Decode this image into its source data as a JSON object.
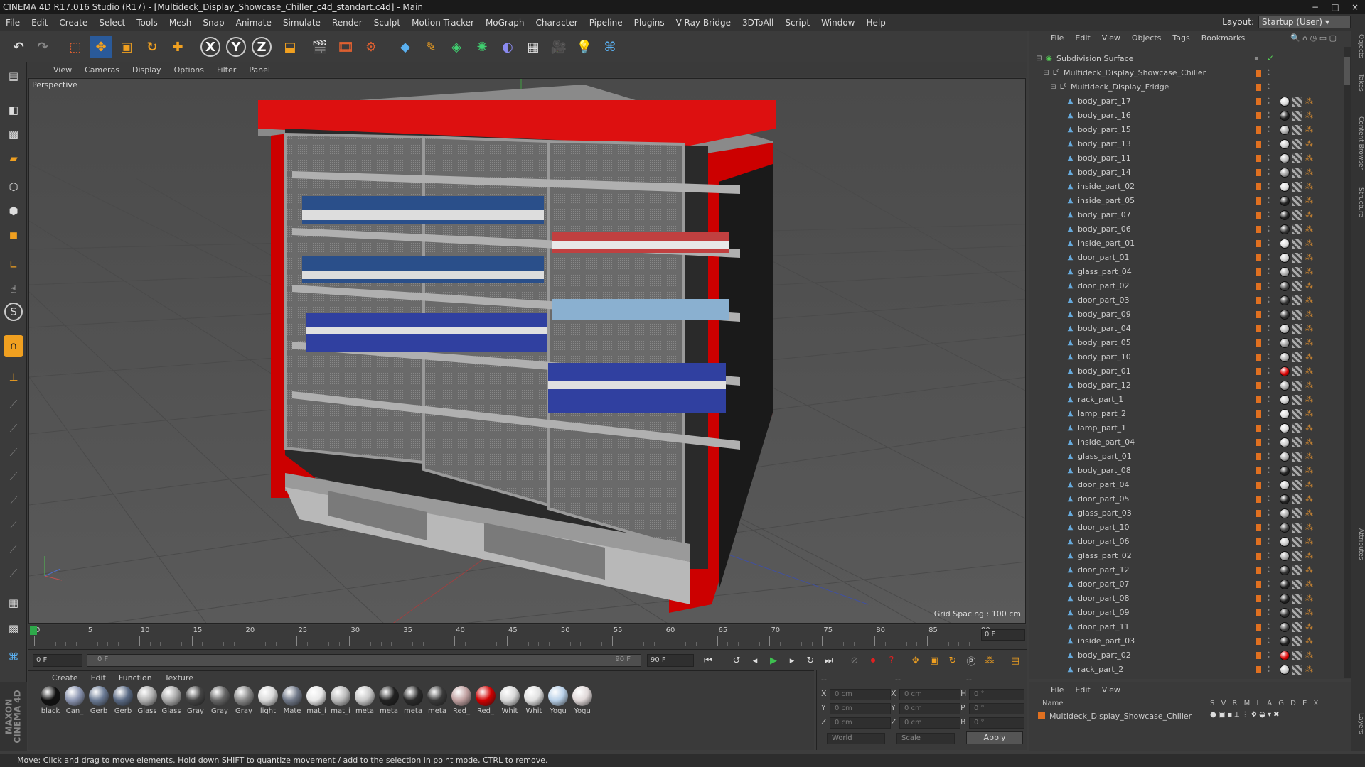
{
  "window": {
    "title": "CINEMA 4D R17.016 Studio (R17) - [Multideck_Display_Showcase_Chiller_c4d_standart.c4d] - Main",
    "controls": [
      "−",
      "□",
      "×"
    ]
  },
  "menu": [
    "File",
    "Edit",
    "Create",
    "Select",
    "Tools",
    "Mesh",
    "Snap",
    "Animate",
    "Simulate",
    "Render",
    "Sculpt",
    "Motion Tracker",
    "MoGraph",
    "Character",
    "Pipeline",
    "Plugins",
    "V-Ray Bridge",
    "3DToAll",
    "Script",
    "Window",
    "Help"
  ],
  "layout": {
    "label": "Layout:",
    "value": "Startup (User)"
  },
  "toolbar": {
    "axis_x": "X",
    "axis_y": "Y",
    "axis_z": "Z"
  },
  "viewport": {
    "menu": [
      "View",
      "Cameras",
      "Display",
      "Options",
      "Filter",
      "Panel"
    ],
    "label": "Perspective",
    "grid": "Grid Spacing : 100 cm"
  },
  "timeline": {
    "ticks": [
      "0",
      "5",
      "10",
      "15",
      "20",
      "25",
      "30",
      "35",
      "40",
      "45",
      "50",
      "55",
      "60",
      "65",
      "70",
      "75",
      "80",
      "85",
      "90"
    ],
    "frame_right": "0 F"
  },
  "anim": {
    "start": "0 F",
    "range_start": "0 F",
    "range_end": "90 F",
    "end": "90 F"
  },
  "materials": {
    "menu": [
      "Create",
      "Edit",
      "Function",
      "Texture"
    ],
    "items": [
      {
        "label": "black",
        "color": "#111111"
      },
      {
        "label": "Can_",
        "color": "#8a94b0"
      },
      {
        "label": "Gerb",
        "color": "#6a7a94"
      },
      {
        "label": "Gerb",
        "color": "#5a6a84"
      },
      {
        "label": "Glass",
        "color": "#b0b0b0"
      },
      {
        "label": "Glass",
        "color": "#a8a8a8"
      },
      {
        "label": "Gray",
        "color": "#444444"
      },
      {
        "label": "Gray",
        "color": "#666666"
      },
      {
        "label": "Gray",
        "color": "#888888"
      },
      {
        "label": "light",
        "color": "#d8d8d8"
      },
      {
        "label": "Mate",
        "color": "#707888"
      },
      {
        "label": "mat_i",
        "color": "#e8e8e8"
      },
      {
        "label": "mat_i",
        "color": "#bbbbbb"
      },
      {
        "label": "meta",
        "color": "#c8c8c8"
      },
      {
        "label": "meta",
        "color": "#222222"
      },
      {
        "label": "meta",
        "color": "#2a2a2a"
      },
      {
        "label": "meta",
        "color": "#3a3a3a"
      },
      {
        "label": "Red_",
        "color": "#c0a0a0"
      },
      {
        "label": "Red_",
        "color": "#d00000"
      },
      {
        "label": "Whit",
        "color": "#d8d8d8"
      },
      {
        "label": "Whit",
        "color": "#e0e0e0"
      },
      {
        "label": "Yogu",
        "color": "#b8d0e8"
      },
      {
        "label": "Yogu",
        "color": "#e0d8d8"
      }
    ]
  },
  "coords": {
    "x": "X",
    "y": "Y",
    "z": "Z",
    "h": "H",
    "p": "P",
    "b": "B",
    "pos": "0 cm",
    "rot": "0 °",
    "dash": "--",
    "world": "World",
    "scale": "Scale",
    "apply": "Apply"
  },
  "objects": {
    "menu": [
      "File",
      "Edit",
      "View",
      "Objects",
      "Tags",
      "Bookmarks"
    ],
    "root": "Subdivision Surface",
    "group": "Multideck_Display_Showcase_Chiller",
    "sub": "Multideck_Display_Fridge",
    "items": [
      {
        "name": "body_part_17",
        "tag": "#dddddd"
      },
      {
        "name": "body_part_16",
        "tag": "#222222"
      },
      {
        "name": "body_part_15",
        "tag": "#aaaaaa"
      },
      {
        "name": "body_part_13",
        "tag": "#cccccc"
      },
      {
        "name": "body_part_11",
        "tag": "#bbbbbb"
      },
      {
        "name": "body_part_14",
        "tag": "#999999"
      },
      {
        "name": "inside_part_02",
        "tag": "#dddddd"
      },
      {
        "name": "inside_part_05",
        "tag": "#222222"
      },
      {
        "name": "body_part_07",
        "tag": "#222222"
      },
      {
        "name": "body_part_06",
        "tag": "#333333"
      },
      {
        "name": "inside_part_01",
        "tag": "#dddddd"
      },
      {
        "name": "door_part_01",
        "tag": "#cccccc"
      },
      {
        "name": "glass_part_04",
        "tag": "#aaaaaa"
      },
      {
        "name": "door_part_02",
        "tag": "#444444"
      },
      {
        "name": "door_part_03",
        "tag": "#333333"
      },
      {
        "name": "body_part_09",
        "tag": "#333333"
      },
      {
        "name": "body_part_04",
        "tag": "#bbbbbb"
      },
      {
        "name": "body_part_05",
        "tag": "#999999"
      },
      {
        "name": "body_part_10",
        "tag": "#aaaaaa"
      },
      {
        "name": "body_part_01",
        "tag": "#dd0000"
      },
      {
        "name": "body_part_12",
        "tag": "#aaaaaa"
      },
      {
        "name": "rack_part_1",
        "tag": "#cccccc"
      },
      {
        "name": "lamp_part_2",
        "tag": "#dddddd"
      },
      {
        "name": "lamp_part_1",
        "tag": "#dddddd"
      },
      {
        "name": "inside_part_04",
        "tag": "#cccccc"
      },
      {
        "name": "glass_part_01",
        "tag": "#aaaaaa"
      },
      {
        "name": "body_part_08",
        "tag": "#222222"
      },
      {
        "name": "door_part_04",
        "tag": "#cccccc"
      },
      {
        "name": "door_part_05",
        "tag": "#222222"
      },
      {
        "name": "glass_part_03",
        "tag": "#aaaaaa"
      },
      {
        "name": "door_part_10",
        "tag": "#444444"
      },
      {
        "name": "door_part_06",
        "tag": "#cccccc"
      },
      {
        "name": "glass_part_02",
        "tag": "#aaaaaa"
      },
      {
        "name": "door_part_12",
        "tag": "#333333"
      },
      {
        "name": "door_part_07",
        "tag": "#222222"
      },
      {
        "name": "door_part_08",
        "tag": "#222222"
      },
      {
        "name": "door_part_09",
        "tag": "#333333"
      },
      {
        "name": "door_part_11",
        "tag": "#444444"
      },
      {
        "name": "inside_part_03",
        "tag": "#222222"
      },
      {
        "name": "body_part_02",
        "tag": "#dd0000"
      },
      {
        "name": "rack_part_2",
        "tag": "#cccccc"
      }
    ]
  },
  "attributes": {
    "menu": [
      "File",
      "Edit",
      "View"
    ],
    "cols": "S V R M L A G D E X",
    "name_col": "Name",
    "row": "Multideck_Display_Showcase_Chiller"
  },
  "sidetabs": [
    "Objects",
    "Takes",
    "Content Browser",
    "Structure",
    "Attributes",
    "Layers"
  ],
  "brand": {
    "line1": "MAXON",
    "line2": "CINEMA 4D"
  },
  "status": "Move: Click and drag to move elements. Hold down SHIFT to quantize movement / add to the selection in point mode, CTRL to remove."
}
